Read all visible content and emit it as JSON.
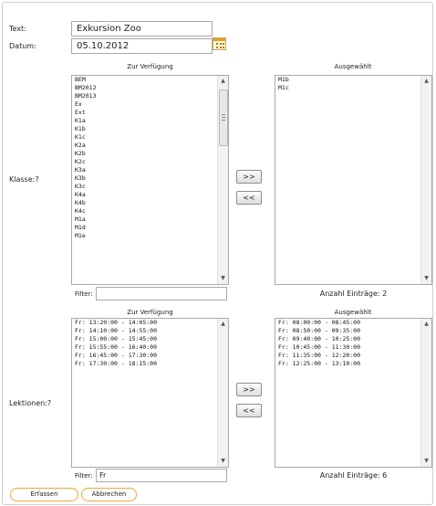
{
  "form": {
    "text_label": "Text:",
    "text_value": "Exkursion Zoo",
    "date_label": "Datum:",
    "date_value": "05.10.2012"
  },
  "klasse": {
    "label": "Klasse:?",
    "available_header": "Zur Verfügung",
    "selected_header": "Ausgewählt",
    "available_items": [
      "BEM",
      "BM2012",
      "BM2013",
      "Ex",
      "Ext",
      "K1a",
      "K1b",
      "K1c",
      "K2a",
      "K2b",
      "K2c",
      "K3a",
      "K3b",
      "K3c",
      "K4a",
      "K4b",
      "K4c",
      "M1a",
      "M1d",
      "M1e"
    ],
    "selected_items": [
      "M1b",
      "M1c"
    ],
    "add_label": ">>",
    "remove_label": "<<",
    "filter_label": "Filter:",
    "filter_value": "",
    "count_text": "Anzahl Einträge: 2"
  },
  "lektionen": {
    "label": "Lektionen:?",
    "available_header": "Zur Verfügung",
    "selected_header": "Ausgewählt",
    "available_items": [
      "Fr: 13:20:00 - 14:05:00",
      "Fr: 14:10:00 - 14:55:00",
      "Fr: 15:00:00 - 15:45:00",
      "Fr: 15:55:00 - 16:40:00",
      "Fr: 16:45:00 - 17:30:00",
      "Fr: 17:30:00 - 18:15:00"
    ],
    "selected_items": [
      "Fr: 08:00:00 - 08:45:00",
      "Fr: 08:50:00 - 09:35:00",
      "Fr: 09:40:00 - 10:25:00",
      "Fr: 10:45:00 - 11:30:00",
      "Fr: 11:35:00 - 12:20:00",
      "Fr: 12:25:00 - 13:10:00"
    ],
    "add_label": ">>",
    "remove_label": "<<",
    "filter_label": "Filter:",
    "filter_value": "Fr",
    "count_text": "Anzahl Einträge: 6"
  },
  "actions": {
    "submit_label": "Erfassen",
    "cancel_label": "Abbrechen",
    "accent_color": "#f0a830"
  },
  "icons": {
    "calendar": "calendar-icon",
    "scroll_up": "scroll-up-arrow-icon",
    "scroll_down": "scroll-down-arrow-icon"
  }
}
